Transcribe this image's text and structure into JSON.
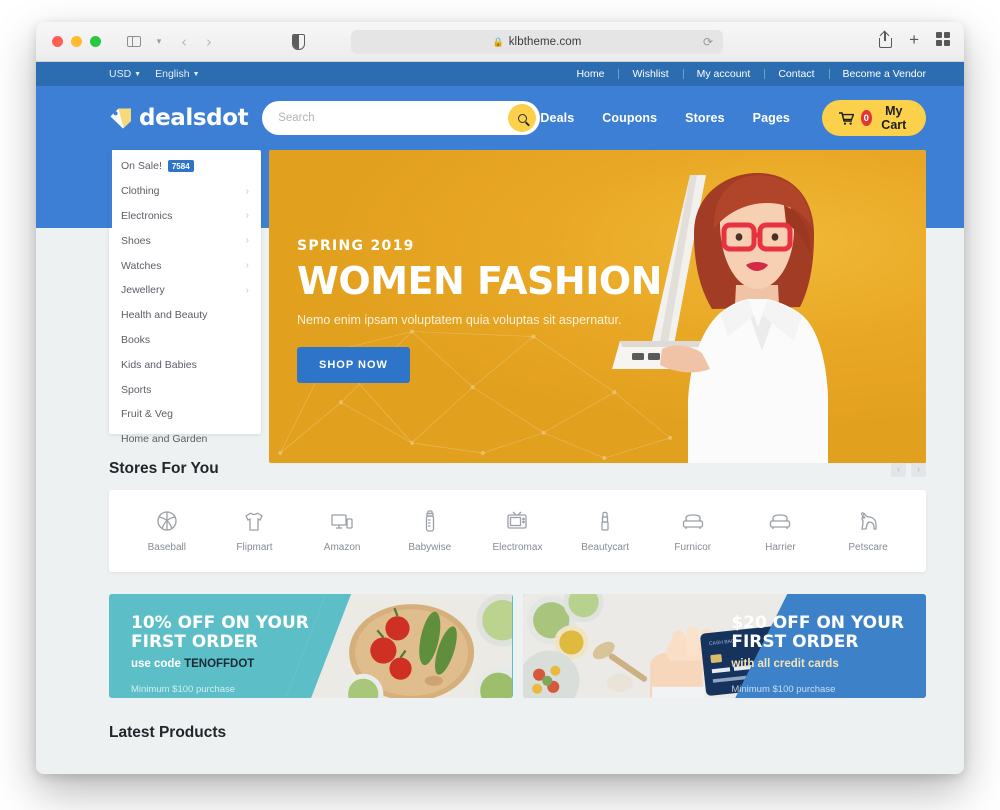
{
  "browser": {
    "url": "klbtheme.com",
    "lock_icon": "lock-icon",
    "reload_icon": "reload-icon",
    "back_icon": "back-arrow-icon",
    "forward_icon": "forward-arrow-icon",
    "sidebar_icon": "sidebar-toggle-icon",
    "tabgroup_icon": "chevron-down-icon",
    "reader_icon": "reader-mode-icon",
    "share_icon": "share-icon",
    "newtab_icon": "plus-icon",
    "tabs_icon": "tab-overview-icon"
  },
  "topbar": {
    "currency": "USD",
    "language": "English",
    "links": [
      "Home",
      "Wishlist",
      "My account",
      "Contact",
      "Become a Vendor"
    ]
  },
  "header": {
    "logo_text": "dealsdot",
    "search_placeholder": "Search",
    "search_value": "",
    "search_icon": "search-icon",
    "nav": [
      "Deals",
      "Coupons",
      "Stores",
      "Pages"
    ],
    "cart_label": "My Cart",
    "cart_count": "0",
    "cart_icon": "shopping-cart-icon"
  },
  "categories": [
    {
      "label": "On Sale!",
      "badge": "7584",
      "has_arrow": false
    },
    {
      "label": "Clothing",
      "badge": "",
      "has_arrow": true
    },
    {
      "label": "Electronics",
      "badge": "",
      "has_arrow": true
    },
    {
      "label": "Shoes",
      "badge": "",
      "has_arrow": true
    },
    {
      "label": "Watches",
      "badge": "",
      "has_arrow": true
    },
    {
      "label": "Jewellery",
      "badge": "",
      "has_arrow": true
    },
    {
      "label": "Health and Beauty",
      "badge": "",
      "has_arrow": false
    },
    {
      "label": "Books",
      "badge": "",
      "has_arrow": false
    },
    {
      "label": "Kids and Babies",
      "badge": "",
      "has_arrow": false
    },
    {
      "label": "Sports",
      "badge": "",
      "has_arrow": false
    },
    {
      "label": "Fruit & Veg",
      "badge": "",
      "has_arrow": false
    },
    {
      "label": "Home and Garden",
      "badge": "",
      "has_arrow": false
    }
  ],
  "hero": {
    "kicker": "SPRING 2019",
    "title": "WOMEN FASHION",
    "subtitle": "Nemo enim ipsam voluptatem quia voluptas sit aspernatur.",
    "cta": "SHOP NOW"
  },
  "stores_section": {
    "title": "Stores For You",
    "prev_icon": "chevron-left-icon",
    "next_icon": "chevron-right-icon",
    "stores": [
      {
        "name": "Baseball",
        "icon": "ball-icon"
      },
      {
        "name": "Flipmart",
        "icon": "tshirt-icon"
      },
      {
        "name": "Amazon",
        "icon": "monitor-icon"
      },
      {
        "name": "Babywise",
        "icon": "baby-bottle-icon"
      },
      {
        "name": "Electromax",
        "icon": "television-icon"
      },
      {
        "name": "Beautycart",
        "icon": "lipstick-icon"
      },
      {
        "name": "Furnicor",
        "icon": "sofa-icon"
      },
      {
        "name": "Harrier",
        "icon": "sofa-icon"
      },
      {
        "name": "Petscare",
        "icon": "pet-icon"
      }
    ]
  },
  "promos": [
    {
      "heading_line1": "10% OFF ON YOUR",
      "heading_line2": "FIRST ORDER",
      "sub_prefix": "use code ",
      "sub_code": "TENOFFDOT",
      "note": "Minimum $100 purchase",
      "color": "#5cbfc8"
    },
    {
      "heading_line1": "$20 OFF ON YOUR",
      "heading_line2": "FIRST ORDER",
      "sub_prefix": "with all credit cards",
      "sub_code": "",
      "note": "Minimum $100 purchase",
      "color": "#3d82c9"
    }
  ],
  "next_section": {
    "title": "Latest Products"
  },
  "colors": {
    "topbar": "#2c6cb0",
    "header": "#3d7fd4",
    "accent_yellow": "#fbd14b",
    "page_bg": "#eef1f2",
    "hero_yellow": "#e8a724",
    "badge_red": "#e03636"
  }
}
